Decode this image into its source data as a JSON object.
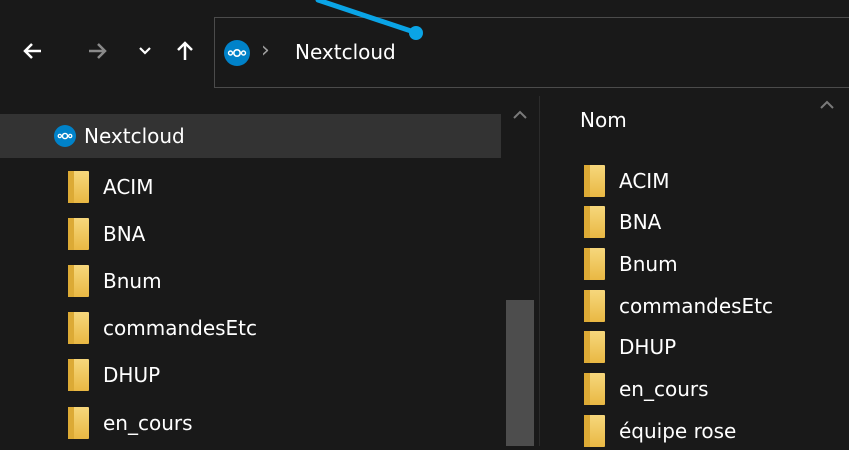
{
  "nav_buttons": {
    "back_icon": "arrow-left-icon",
    "forward_icon": "arrow-right-icon",
    "recent_icon": "chevron-down-icon",
    "up_icon": "arrow-up-icon"
  },
  "address_bar": {
    "icon": "nextcloud-icon",
    "separator": "›",
    "location": "Nextcloud"
  },
  "nav_pane": {
    "root": {
      "label": "Nextcloud",
      "icon": "nextcloud-icon"
    },
    "folders": [
      {
        "label": "ACIM"
      },
      {
        "label": "BNA"
      },
      {
        "label": "Bnum"
      },
      {
        "label": "commandesEtc"
      },
      {
        "label": "DHUP"
      },
      {
        "label": "en_cours"
      }
    ]
  },
  "content_pane": {
    "column_header": "Nom",
    "items": [
      {
        "label": "ACIM"
      },
      {
        "label": "BNA"
      },
      {
        "label": "Bnum"
      },
      {
        "label": "commandesEtc"
      },
      {
        "label": "DHUP"
      },
      {
        "label": "en_cours"
      },
      {
        "label": "équipe rose"
      }
    ]
  },
  "colors": {
    "background": "#191919",
    "selection": "#333333",
    "nextcloud_blue": "#0082c9",
    "folder": "#f6d77c",
    "annotation": "#0aa4e6"
  }
}
